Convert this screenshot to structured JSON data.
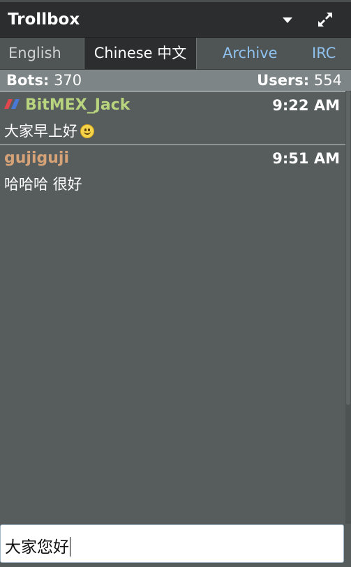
{
  "header": {
    "title": "Trollbox",
    "dropdown_icon": "caret-down-icon",
    "expand_icon": "expand-arrows-icon"
  },
  "tabs": [
    {
      "label": "English",
      "active": false
    },
    {
      "label": "Chinese 中文",
      "active": true
    },
    {
      "label": "Archive",
      "active": false,
      "link": true
    },
    {
      "label": "IRC",
      "active": false,
      "link": true
    }
  ],
  "stats": {
    "bots_label": "Bots:",
    "bots_count": "370",
    "users_label": "Users:",
    "users_count": "554"
  },
  "messages": [
    {
      "user": "BitMEX_Jack",
      "user_color": "#b9d47e",
      "badge_icon": "bitmex-logo-icon",
      "time": "9:22 AM",
      "text": "大家早上好",
      "emoji": "smiley-face-icon"
    },
    {
      "user": "gujiguji",
      "user_color": "#d6a277",
      "time": "9:51 AM",
      "text": "哈哈哈 很好"
    }
  ],
  "input": {
    "value": "大家您好"
  },
  "colors": {
    "header_bg": "#2b2d2f",
    "panel_bg": "#575c5c",
    "link": "#8fc1ee",
    "stats_bg": "#7d8587"
  }
}
